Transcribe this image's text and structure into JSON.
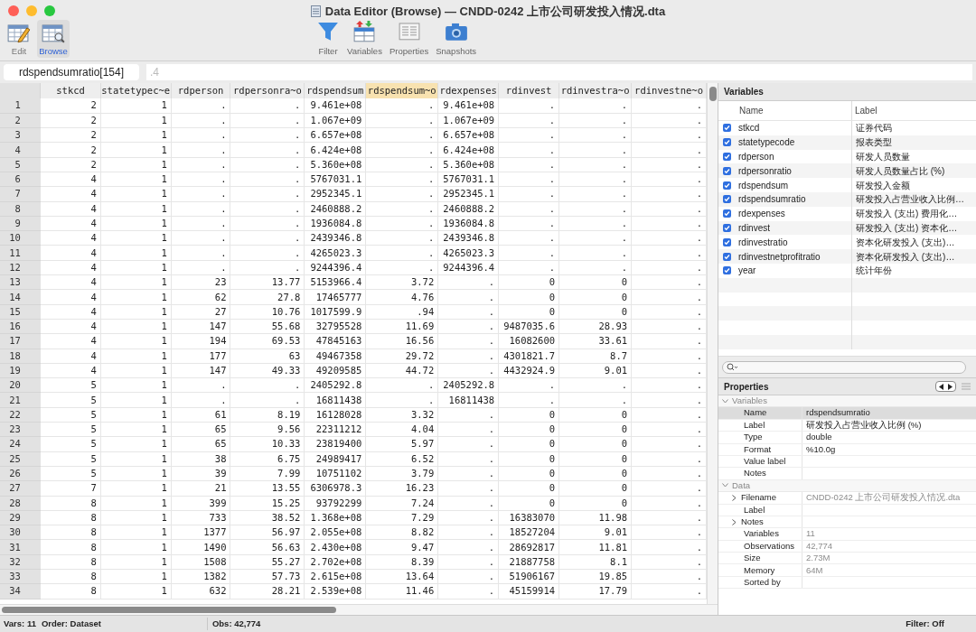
{
  "window": {
    "title": "Data Editor (Browse) — CNDD-0242 上市公司研发投入情况.dta"
  },
  "mode_buttons": [
    {
      "label": "Edit",
      "selected": false,
      "kind": "edit"
    },
    {
      "label": "Browse",
      "selected": true,
      "kind": "browse"
    }
  ],
  "toolbar": [
    {
      "label": "Filter",
      "kind": "filter"
    },
    {
      "label": "Variables",
      "kind": "variables"
    },
    {
      "label": "Properties",
      "kind": "properties"
    },
    {
      "label": "Snapshots",
      "kind": "snapshots"
    }
  ],
  "cell_editor": {
    "cell": "rdspendsumratio[154]",
    "value": ".4"
  },
  "table": {
    "columns": [
      {
        "label": "stkcd",
        "selected": false
      },
      {
        "label": "statetypec~e",
        "selected": false
      },
      {
        "label": "rdperson",
        "selected": false
      },
      {
        "label": "rdpersonra~o",
        "selected": false
      },
      {
        "label": "rdspendsum",
        "selected": false
      },
      {
        "label": "rdspendsum~o",
        "selected": true
      },
      {
        "label": "rdexpenses",
        "selected": false
      },
      {
        "label": "rdinvest",
        "selected": false
      },
      {
        "label": "rdinvestra~o",
        "selected": false
      },
      {
        "label": "rdinvestne~o",
        "selected": false
      }
    ],
    "rows": [
      {
        "number": "1",
        "cells": [
          "2",
          "1",
          ".",
          ".",
          "9.461e+08",
          ".",
          "9.461e+08",
          ".",
          ".",
          "."
        ]
      },
      {
        "number": "2",
        "cells": [
          "2",
          "1",
          ".",
          ".",
          "1.067e+09",
          ".",
          "1.067e+09",
          ".",
          ".",
          "."
        ]
      },
      {
        "number": "3",
        "cells": [
          "2",
          "1",
          ".",
          ".",
          "6.657e+08",
          ".",
          "6.657e+08",
          ".",
          ".",
          "."
        ]
      },
      {
        "number": "4",
        "cells": [
          "2",
          "1",
          ".",
          ".",
          "6.424e+08",
          ".",
          "6.424e+08",
          ".",
          ".",
          "."
        ]
      },
      {
        "number": "5",
        "cells": [
          "2",
          "1",
          ".",
          ".",
          "5.360e+08",
          ".",
          "5.360e+08",
          ".",
          ".",
          "."
        ]
      },
      {
        "number": "6",
        "cells": [
          "4",
          "1",
          ".",
          ".",
          "5767031.1",
          ".",
          "5767031.1",
          ".",
          ".",
          "."
        ]
      },
      {
        "number": "7",
        "cells": [
          "4",
          "1",
          ".",
          ".",
          "2952345.1",
          ".",
          "2952345.1",
          ".",
          ".",
          "."
        ]
      },
      {
        "number": "8",
        "cells": [
          "4",
          "1",
          ".",
          ".",
          "2460888.2",
          ".",
          "2460888.2",
          ".",
          ".",
          "."
        ]
      },
      {
        "number": "9",
        "cells": [
          "4",
          "1",
          ".",
          ".",
          "1936084.8",
          ".",
          "1936084.8",
          ".",
          ".",
          "."
        ]
      },
      {
        "number": "10",
        "cells": [
          "4",
          "1",
          ".",
          ".",
          "2439346.8",
          ".",
          "2439346.8",
          ".",
          ".",
          "."
        ]
      },
      {
        "number": "11",
        "cells": [
          "4",
          "1",
          ".",
          ".",
          "4265023.3",
          ".",
          "4265023.3",
          ".",
          ".",
          "."
        ]
      },
      {
        "number": "12",
        "cells": [
          "4",
          "1",
          ".",
          ".",
          "9244396.4",
          ".",
          "9244396.4",
          ".",
          ".",
          "."
        ]
      },
      {
        "number": "13",
        "cells": [
          "4",
          "1",
          "23",
          "13.77",
          "5153966.4",
          "3.72",
          ".",
          "0",
          "0",
          "."
        ]
      },
      {
        "number": "14",
        "cells": [
          "4",
          "1",
          "62",
          "27.8",
          "17465777",
          "4.76",
          ".",
          "0",
          "0",
          "."
        ]
      },
      {
        "number": "15",
        "cells": [
          "4",
          "1",
          "27",
          "10.76",
          "1017599.9",
          ".94",
          ".",
          "0",
          "0",
          "."
        ]
      },
      {
        "number": "16",
        "cells": [
          "4",
          "1",
          "147",
          "55.68",
          "32795528",
          "11.69",
          ".",
          "9487035.6",
          "28.93",
          "."
        ]
      },
      {
        "number": "17",
        "cells": [
          "4",
          "1",
          "194",
          "69.53",
          "47845163",
          "16.56",
          ".",
          "16082600",
          "33.61",
          "."
        ]
      },
      {
        "number": "18",
        "cells": [
          "4",
          "1",
          "177",
          "63",
          "49467358",
          "29.72",
          ".",
          "4301821.7",
          "8.7",
          "."
        ]
      },
      {
        "number": "19",
        "cells": [
          "4",
          "1",
          "147",
          "49.33",
          "49209585",
          "44.72",
          ".",
          "4432924.9",
          "9.01",
          "."
        ]
      },
      {
        "number": "20",
        "cells": [
          "5",
          "1",
          ".",
          ".",
          "2405292.8",
          ".",
          "2405292.8",
          ".",
          ".",
          "."
        ]
      },
      {
        "number": "21",
        "cells": [
          "5",
          "1",
          ".",
          ".",
          "16811438",
          ".",
          "16811438",
          ".",
          ".",
          "."
        ]
      },
      {
        "number": "22",
        "cells": [
          "5",
          "1",
          "61",
          "8.19",
          "16128028",
          "3.32",
          ".",
          "0",
          "0",
          "."
        ]
      },
      {
        "number": "23",
        "cells": [
          "5",
          "1",
          "65",
          "9.56",
          "22311212",
          "4.04",
          ".",
          "0",
          "0",
          "."
        ]
      },
      {
        "number": "24",
        "cells": [
          "5",
          "1",
          "65",
          "10.33",
          "23819400",
          "5.97",
          ".",
          "0",
          "0",
          "."
        ]
      },
      {
        "number": "25",
        "cells": [
          "5",
          "1",
          "38",
          "6.75",
          "24989417",
          "6.52",
          ".",
          "0",
          "0",
          "."
        ]
      },
      {
        "number": "26",
        "cells": [
          "5",
          "1",
          "39",
          "7.99",
          "10751102",
          "3.79",
          ".",
          "0",
          "0",
          "."
        ]
      },
      {
        "number": "27",
        "cells": [
          "7",
          "1",
          "21",
          "13.55",
          "6306978.3",
          "16.23",
          ".",
          "0",
          "0",
          "."
        ]
      },
      {
        "number": "28",
        "cells": [
          "8",
          "1",
          "399",
          "15.25",
          "93792299",
          "7.24",
          ".",
          "0",
          "0",
          "."
        ]
      },
      {
        "number": "29",
        "cells": [
          "8",
          "1",
          "733",
          "38.52",
          "1.368e+08",
          "7.29",
          ".",
          "16383070",
          "11.98",
          "."
        ]
      },
      {
        "number": "30",
        "cells": [
          "8",
          "1",
          "1377",
          "56.97",
          "2.055e+08",
          "8.82",
          ".",
          "18527204",
          "9.01",
          "."
        ]
      },
      {
        "number": "31",
        "cells": [
          "8",
          "1",
          "1490",
          "56.63",
          "2.430e+08",
          "9.47",
          ".",
          "28692817",
          "11.81",
          "."
        ]
      },
      {
        "number": "32",
        "cells": [
          "8",
          "1",
          "1508",
          "55.27",
          "2.702e+08",
          "8.39",
          ".",
          "21887758",
          "8.1",
          "."
        ]
      },
      {
        "number": "33",
        "cells": [
          "8",
          "1",
          "1382",
          "57.73",
          "2.615e+08",
          "13.64",
          ".",
          "51906167",
          "19.85",
          "."
        ]
      },
      {
        "number": "34",
        "cells": [
          "8",
          "1",
          "632",
          "28.21",
          "2.539e+08",
          "11.46",
          ".",
          "45159914",
          "17.79",
          "."
        ]
      }
    ]
  },
  "variables_panel": {
    "title": "Variables",
    "columns": [
      "Name",
      "Label"
    ],
    "items": [
      {
        "name": "stkcd",
        "label": "证券代码",
        "checked": true
      },
      {
        "name": "statetypecode",
        "label": "报表类型",
        "checked": true
      },
      {
        "name": "rdperson",
        "label": "研发人员数量",
        "checked": true
      },
      {
        "name": "rdpersonratio",
        "label": "研发人员数量占比 (%)",
        "checked": true
      },
      {
        "name": "rdspendsum",
        "label": "研发投入金额",
        "checked": true
      },
      {
        "name": "rdspendsumratio",
        "label": "研发投入占营业收入比例…",
        "checked": true
      },
      {
        "name": "rdexpenses",
        "label": "研发投入 (支出) 费用化…",
        "checked": true
      },
      {
        "name": "rdinvest",
        "label": "研发投入 (支出) 资本化…",
        "checked": true
      },
      {
        "name": "rdinvestratio",
        "label": "资本化研发投入 (支出)…",
        "checked": true
      },
      {
        "name": "rdinvestnetprofitratio",
        "label": "资本化研发投入 (支出)…",
        "checked": true
      },
      {
        "name": "year",
        "label": "统计年份",
        "checked": true
      }
    ]
  },
  "properties_panel": {
    "title": "Properties",
    "sections": [
      {
        "title": "Variables",
        "expanded": true,
        "rows": [
          {
            "name": "Name",
            "value": "rdspendsumratio",
            "selected": true
          },
          {
            "name": "Label",
            "value": "研发投入占营业收入比例 (%)",
            "selected": false
          },
          {
            "name": "Type",
            "value": "double",
            "selected": false
          },
          {
            "name": "Format",
            "value": "%10.0g",
            "selected": false
          },
          {
            "name": "Value label",
            "selected": false
          },
          {
            "name": "Notes",
            "selected": false
          }
        ]
      },
      {
        "title": "Data",
        "expanded": true,
        "rows": [
          {
            "name": "Filename",
            "value": "CNDD-0242 上市公司研发投入情况.dta",
            "selected": false,
            "dimmed": true,
            "expandable": true
          },
          {
            "name": "Label",
            "selected": false
          },
          {
            "name": "Notes",
            "selected": false,
            "expandable": true
          },
          {
            "name": "Variables",
            "value": "11",
            "selected": false,
            "dimmed": true
          },
          {
            "name": "Observations",
            "value": "42,774",
            "selected": false,
            "dimmed": true
          },
          {
            "name": "Size",
            "value": "2.73M",
            "selected": false,
            "dimmed": true
          },
          {
            "name": "Memory",
            "value": "64M",
            "selected": false,
            "dimmed": true
          },
          {
            "name": "Sorted by",
            "selected": false
          }
        ]
      }
    ]
  },
  "status_bar": {
    "vars": "Vars: 11",
    "order": "Order: Dataset",
    "obs": "Obs: 42,774",
    "filter": "Filter: Off"
  }
}
